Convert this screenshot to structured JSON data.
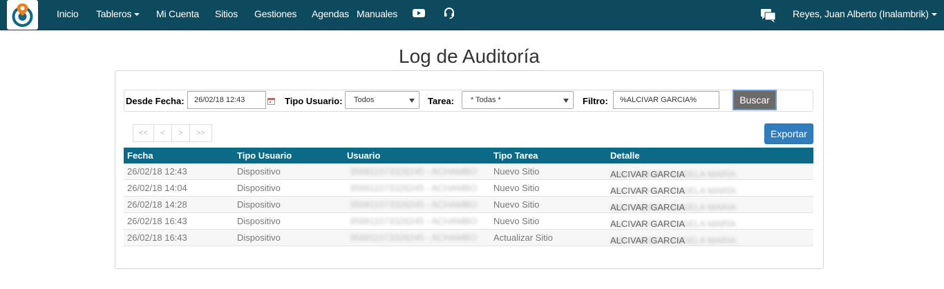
{
  "nav": {
    "items": [
      {
        "label": "Inicio"
      },
      {
        "label": "Tableros"
      },
      {
        "label": "Mi Cuenta"
      },
      {
        "label": "Sitios"
      },
      {
        "label": "Gestiones"
      },
      {
        "label": "Agendas"
      },
      {
        "label": "Manuales"
      }
    ],
    "user": "Reyes, Juan Alberto (Inalambrik)",
    "icons": [
      "youtube-icon",
      "headset-icon",
      "chat-icon"
    ]
  },
  "page": {
    "title": "Log de Auditoría"
  },
  "filters": {
    "desde_label": "Desde Fecha:",
    "desde_value": "26/02/18 12:43",
    "tipo_label": "Tipo Usuario:",
    "tipo_value": "Todos",
    "tarea_label": "Tarea:",
    "tarea_value": "* Todas *",
    "filtro_label": "Filtro:",
    "filtro_value": "%ALCIVAR GARCIA%",
    "buscar_label": "Buscar"
  },
  "pager": [
    "<<",
    "<",
    ">",
    ">>"
  ],
  "export_label": "Exportar",
  "table": {
    "headers": [
      "Fecha",
      "Tipo Usuario",
      "Usuario",
      "Tipo Tarea",
      "Detalle"
    ],
    "rows": [
      {
        "fecha": "26/02/18 12:43",
        "tipo": "Dispositivo",
        "usuario": "356811073326245 - ACHAMBO",
        "tarea": "Nuevo Sitio",
        "detalle_prefix": "Sitio #AE0658 ANGELA MARÍA",
        "detalle_name": "ALCIVAR GARCIA"
      },
      {
        "fecha": "26/02/18 14:04",
        "tipo": "Dispositivo",
        "usuario": "356811073326245 - ACHAMBO",
        "tarea": "Nuevo Sitio",
        "detalle_prefix": "Sitio #AE0618 ANGELA MARÍA",
        "detalle_name": "ALCIVAR GARCIA"
      },
      {
        "fecha": "26/02/18 14:28",
        "tipo": "Dispositivo",
        "usuario": "356811073326245 - ACHAMBO",
        "tarea": "Nuevo Sitio",
        "detalle_prefix": "Sitio #AE0624 ANGELA MARÍA",
        "detalle_name": "ALCIVAR GARCIA"
      },
      {
        "fecha": "26/02/18 16:43",
        "tipo": "Dispositivo",
        "usuario": "356811073326245 - ACHAMBO",
        "tarea": "Nuevo Sitio",
        "detalle_prefix": "Sitio #AE0676 ANGELA MARÍA",
        "detalle_name": "ALCIVAR GARCIA"
      },
      {
        "fecha": "26/02/18 16:43",
        "tipo": "Dispositivo",
        "usuario": "356811073326245 - ACHAMBO",
        "tarea": "Actualizar Sitio",
        "detalle_prefix": "Sitio #AE0676 ANGELA MARÍA",
        "detalle_name": "ALCIVAR GARCIA"
      }
    ]
  },
  "colors": {
    "navbar": "#0d4a5e",
    "table_header": "#0d6a86",
    "export_button": "#2f7dbc",
    "search_button": "#6b6b6b",
    "logo_accent": "#f07c1a"
  }
}
